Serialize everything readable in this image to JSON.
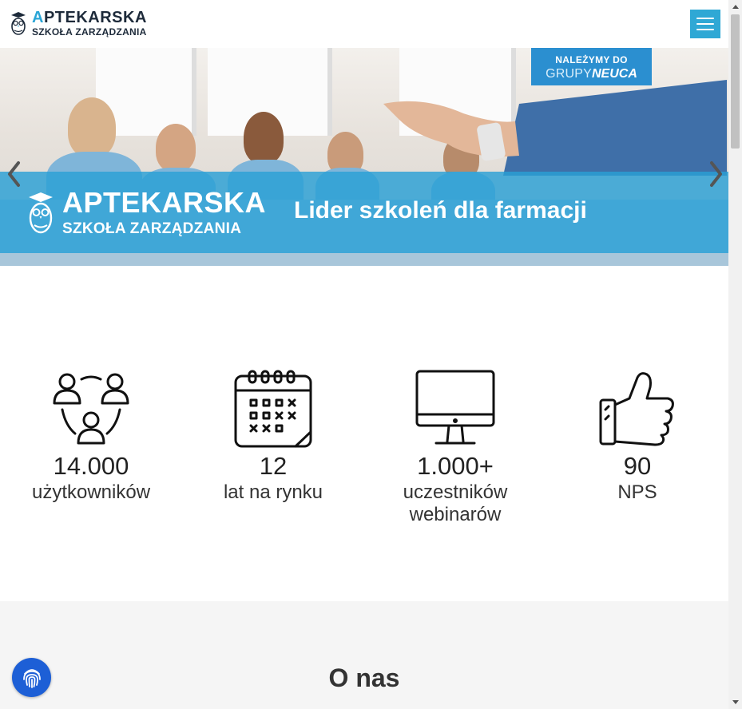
{
  "header": {
    "logo_main_initial": "A",
    "logo_main_rest": "PTEKARSKA",
    "logo_sub": "SZKOŁA ZARZĄDZANIA",
    "menu_icon": "hamburger-icon"
  },
  "hero": {
    "badge_line1": "NALEŻYMY DO",
    "badge_line2_thin": "GRUPY",
    "badge_line2_bold": "NEUCA",
    "band_logo_main": "APTEKARSKA",
    "band_logo_sub": "SZKOŁA ZARZĄDZANIA",
    "tagline": "Lider szkoleń dla farmacji",
    "prev_icon": "chevron-left-icon",
    "next_icon": "chevron-right-icon"
  },
  "stats": [
    {
      "icon": "users-icon",
      "number": "14.000",
      "label": "użytkowników"
    },
    {
      "icon": "calendar-icon",
      "number": "12",
      "label": "lat na rynku"
    },
    {
      "icon": "monitor-icon",
      "number": "1.000+",
      "label": "uczestników webinarów"
    },
    {
      "icon": "thumbs-up-icon",
      "number": "90",
      "label": "NPS"
    }
  ],
  "about": {
    "title": "O nas"
  },
  "colors": {
    "accent": "#2fa8d5",
    "band": "#29a0d6",
    "badge": "#2b8fd0",
    "fingerprint": "#1d5fd6"
  }
}
